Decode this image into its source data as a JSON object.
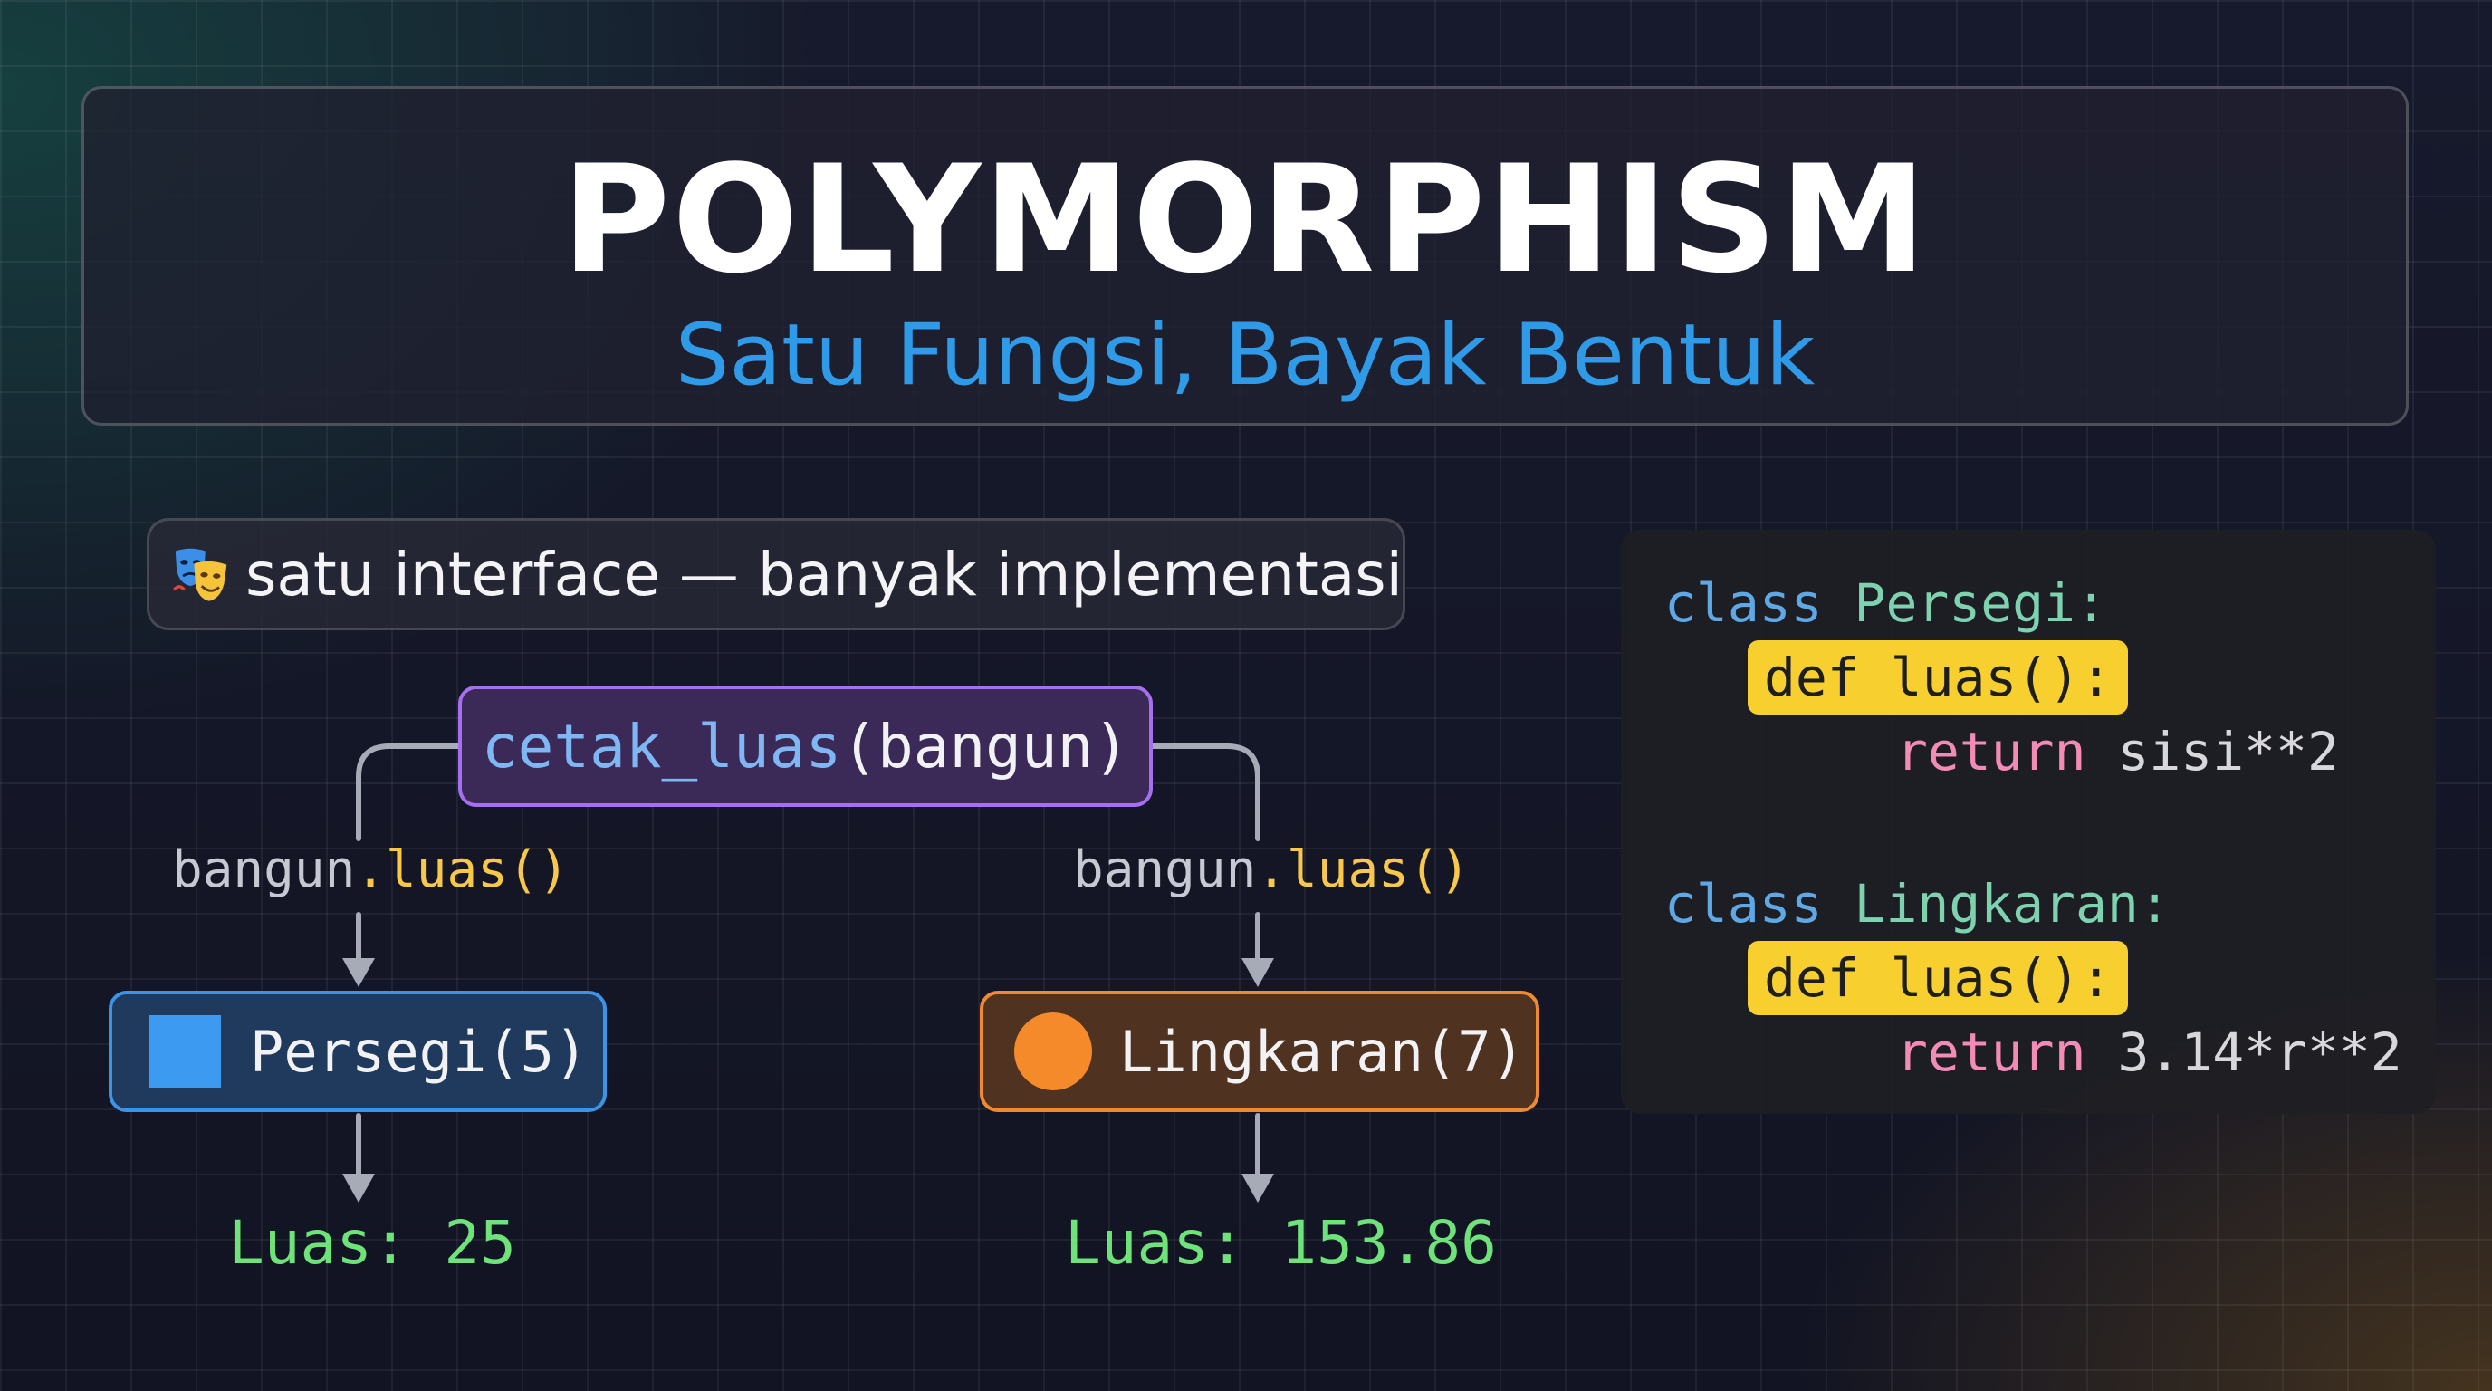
{
  "header": {
    "title": "POLYMORPHISM",
    "subtitle": "Satu Fungsi, Bayak Bentuk"
  },
  "tagline": {
    "icon": "performing-arts-masks-icon",
    "text": "satu interface — banyak implementasi"
  },
  "diagram": {
    "function_call": {
      "name": "cetak_luas",
      "args": "(bangun)"
    },
    "branches": [
      {
        "call_object": "bangun",
        "call_method": ".luas()",
        "shape_icon": "square-icon",
        "shape_label": "Persegi(5)",
        "result": "Luas: 25",
        "color": "#3c94e6"
      },
      {
        "call_object": "bangun",
        "call_method": ".luas()",
        "shape_icon": "circle-icon",
        "shape_label": "Lingkaran(7)",
        "result": "Luas: 153.86",
        "color": "#f08a32"
      }
    ]
  },
  "code": {
    "classes": [
      {
        "keyword": "class",
        "name": "Persegi:",
        "method": "def luas():",
        "return_keyword": "return",
        "return_expr": "sisi**2"
      },
      {
        "keyword": "class",
        "name": "Lingkaran:",
        "method": "def luas():",
        "return_keyword": "return",
        "return_expr": "3.14*r**2"
      }
    ]
  },
  "colors": {
    "title": "#ffffff",
    "subtitle": "#2f9be8",
    "function_border": "#a56ff0",
    "result_text": "#6ee37a",
    "method_highlight": "#f7cf2e"
  }
}
